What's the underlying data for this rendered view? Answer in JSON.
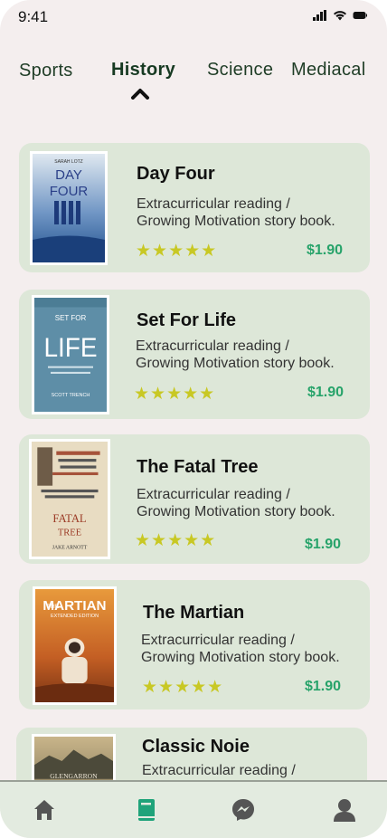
{
  "status_bar": {
    "time": "9:41",
    "icons": [
      "signal-icon",
      "wifi-icon",
      "battery-icon"
    ]
  },
  "tabs": [
    {
      "label": "Sports",
      "active": false
    },
    {
      "label": "History",
      "active": true
    },
    {
      "label": "Science",
      "active": false
    },
    {
      "label": "Mediacal",
      "active": false
    }
  ],
  "books": [
    {
      "title": "Day Four",
      "desc_line1": "Extracurricular reading /",
      "desc_line2": "Growing Motivation story book.",
      "rating": "★★★★★",
      "price": "$1.90",
      "cover_text": [
        "SARAH LOTZ",
        "DAY",
        "FOUR"
      ]
    },
    {
      "title": "Set For Life",
      "desc_line1": "Extracurricular reading /",
      "desc_line2": "Growing Motivation story book.",
      "rating": "★★★★★",
      "price": "$1.90",
      "cover_text": [
        "SET FOR",
        "LIFE",
        "SCOTT TRENCH"
      ]
    },
    {
      "title": "The Fatal Tree",
      "desc_line1": "Extracurricular reading /",
      "desc_line2": "Growing Motivation story book.",
      "rating": "★★★★★",
      "price": "$1.90",
      "cover_text": [
        "FATAL",
        "TREE",
        "JAKE ARNOTT"
      ]
    },
    {
      "title": "The Martian",
      "desc_line1": "Extracurricular reading /",
      "desc_line2": "Growing Motivation story book.",
      "rating": "★★★★★",
      "price": "$1.90",
      "cover_text": [
        "THE",
        "MARTIAN",
        "EXTENDED EDITION"
      ]
    },
    {
      "title": "Classic Noie",
      "desc_line1": "Extracurricular reading /",
      "cover_text": [
        "GLENGARRON"
      ]
    }
  ],
  "bottom_nav": [
    {
      "icon": "home-icon",
      "active": false
    },
    {
      "icon": "book-icon",
      "active": true
    },
    {
      "icon": "messenger-icon",
      "active": false
    },
    {
      "icon": "profile-icon",
      "active": false
    }
  ],
  "colors": {
    "background": "#f4eeee",
    "card": "#dde7d8",
    "tab_text": "#1f3d26",
    "price": "#27a36a",
    "stars": "#c8c824",
    "nav_active": "#1fa37a",
    "nav_inactive": "#555555"
  }
}
